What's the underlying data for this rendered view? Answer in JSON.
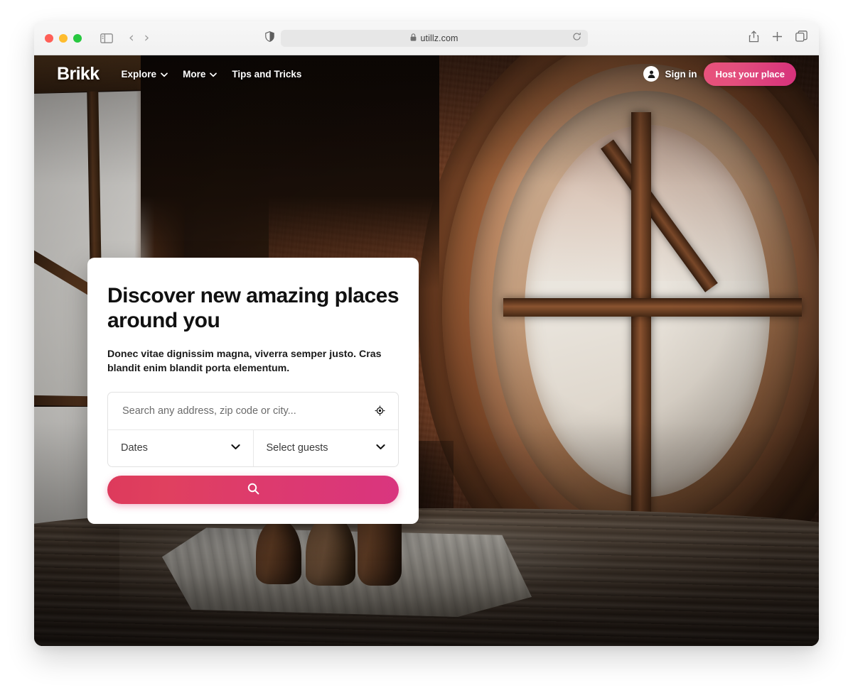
{
  "browser": {
    "url": "utillz.com",
    "lock_icon": "lock-icon",
    "shield_icon": "shield-icon",
    "reload_icon": "reload-icon",
    "sidebar_icon": "sidebar-toggle-icon",
    "back_icon": "‹",
    "forward_icon": "›",
    "share_icon": "share-icon",
    "new_tab_icon": "plus-icon",
    "tabs_icon": "tab-overview-icon"
  },
  "site": {
    "logo": "Brikk",
    "nav": [
      {
        "label": "Explore",
        "has_dropdown": true
      },
      {
        "label": "More",
        "has_dropdown": true
      },
      {
        "label": "Tips and Tricks",
        "has_dropdown": false
      }
    ],
    "sign_in": "Sign in",
    "host_button": "Host your place"
  },
  "hero": {
    "title": "Discover new amazing places around you",
    "subtitle": "Donec vitae dignissim magna, viverra semper justo. Cras blandit enim blandit porta elementum.",
    "search": {
      "placeholder": "Search any address, zip code or city...",
      "value": "",
      "locate_icon": "crosshair-location-icon"
    },
    "dates": {
      "label": "Dates",
      "caret": "❯"
    },
    "guests": {
      "label": "Select guests",
      "caret": "❯"
    },
    "search_button_icon": "search-icon"
  },
  "colors": {
    "accent_start": "#dd3a5c",
    "accent_end": "#d9357f",
    "host_button_start": "#e8527c",
    "host_button_end": "#d6317c",
    "card_bg": "#ffffff",
    "text_dark": "#111111"
  }
}
